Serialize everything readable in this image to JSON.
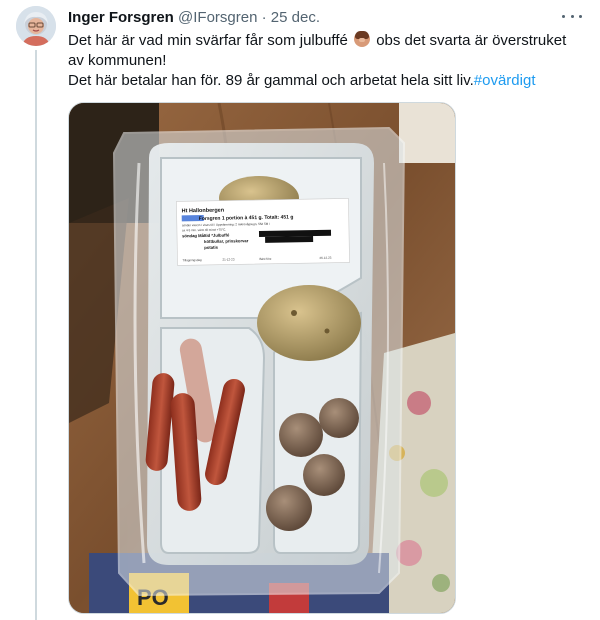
{
  "author": {
    "name": "Inger Forsgren",
    "handle": "@IForsgren",
    "separator": "·",
    "date": "25 dec."
  },
  "tweet": {
    "line1": "Det här är vad min svärfar får som julbuffé",
    "line1_after_emoji": "obs det svarta är överstruket av kommunen!",
    "line2": "Det här betalar han för. 89 år gammal och arbetat hela sitt liv.",
    "hashtag": "#ovärdigt"
  },
  "icons": {
    "more": "more-horizontal-icon",
    "emoji": "face-palm-emoji-icon"
  },
  "label": {
    "header": "Ht Hallonbergen",
    "line1": "Forsgren 1 portion à 451 g. Totalt: 451 g",
    "line2": "sönder vaccin / visas till / Uppvärmning: 2 mikrovågsugn, 55ö 5M /",
    "line3": "ca 4-5 min. värm till minst +75°C.",
    "line4": "söndag Måltid *Julbuffé",
    "line5": "köttbullar, prinskorvar",
    "line6": "potatis",
    "footer_left": "Tillagningsdag",
    "footer_date1": "21-12-23",
    "footer_mid": "Bäst före",
    "footer_date2": "26-12-23"
  },
  "colors": {
    "link": "#1d9bf0",
    "text": "#0f1419",
    "muted": "#536471",
    "border": "#cfd9de"
  }
}
